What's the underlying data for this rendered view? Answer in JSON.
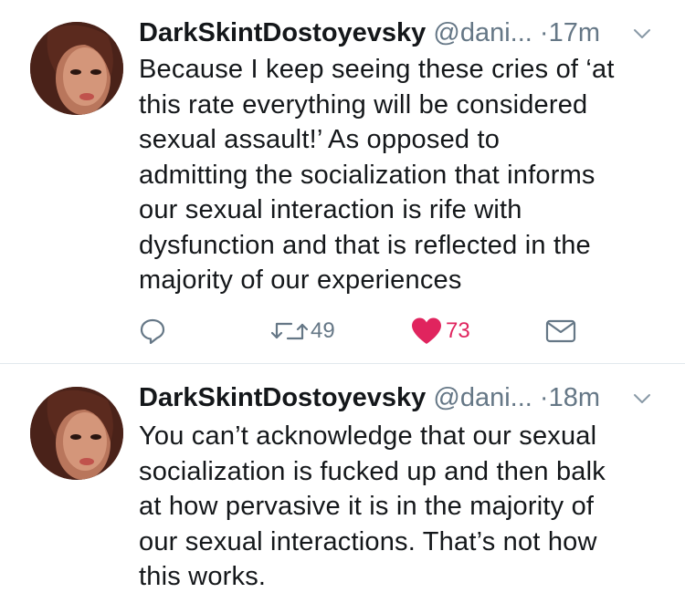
{
  "tweets": [
    {
      "display_name": "DarkSkintDostoyevsky",
      "handle": "@dani...",
      "separator": "·",
      "time": "17m",
      "text": "Because I keep seeing these cries of ‘at\nthis rate everything will be considered\nsexual assault!’ As opposed to\nadmitting the socialization that informs\nour sexual interaction is rife with\ndysfunction and that is reflected in the\nmajority of our experiences",
      "actions": {
        "reply_icon": "reply-icon",
        "retweet_icon": "retweet-icon",
        "retweet_count": "49",
        "like_icon": "heart-icon",
        "like_count": "73",
        "liked": true,
        "dm_icon": "envelope-icon"
      }
    },
    {
      "display_name": "DarkSkintDostoyevsky",
      "handle": "@dani...",
      "separator": "·",
      "time": "18m",
      "text": "You can’t acknowledge that our sexual\nsocialization is fucked up and then balk\nat how pervasive it is in the majority of\nour sexual interactions. That’s not how\nthis works."
    }
  ],
  "colors": {
    "text": "#14171a",
    "secondary": "#657786",
    "like": "#e0245e",
    "divider": "#e1e8ed"
  }
}
